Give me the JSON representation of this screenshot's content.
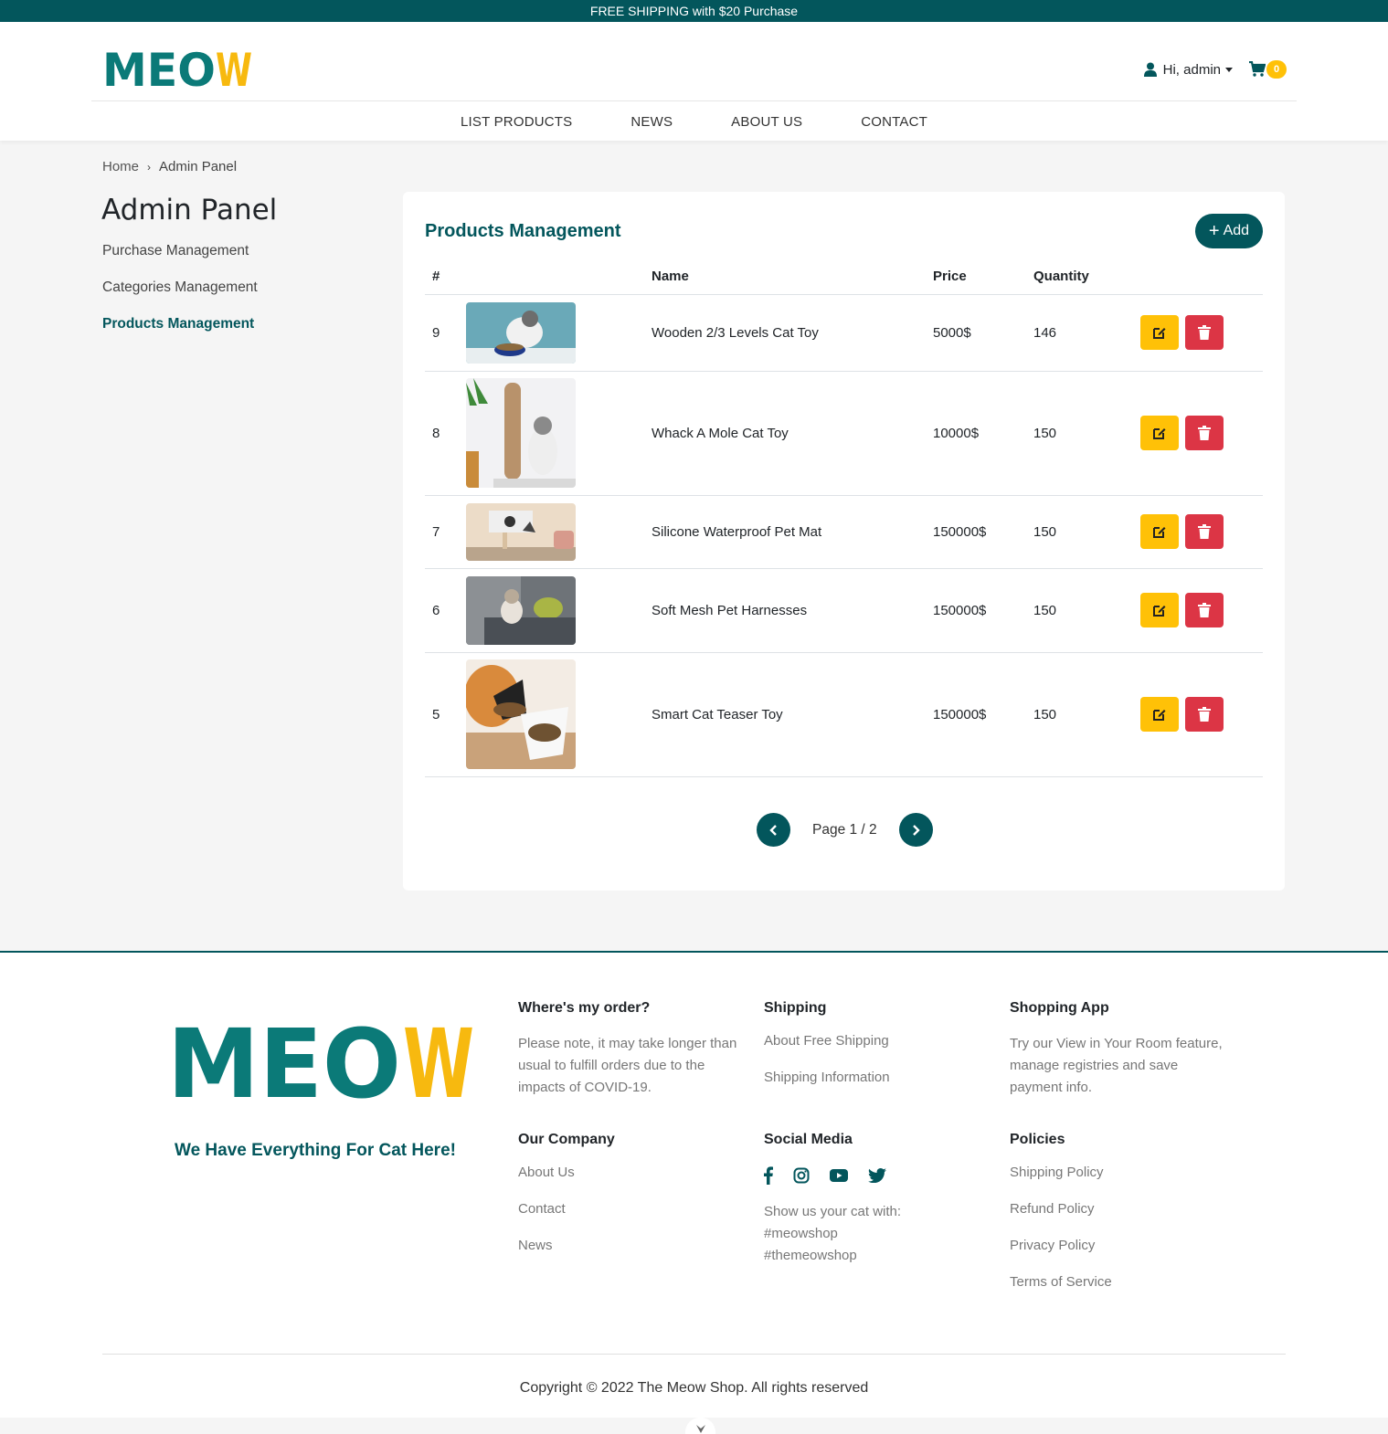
{
  "topbar": {
    "text": "FREE SHIPPING with $20 Purchase"
  },
  "header": {
    "logo_text": "MEOW",
    "greeting": "Hi,",
    "username": "admin",
    "cart_count": "0"
  },
  "nav": [
    "LIST PRODUCTS",
    "NEWS",
    "ABOUT US",
    "CONTACT"
  ],
  "breadcrumb": {
    "home": "Home",
    "current": "Admin Panel"
  },
  "page_title": "Admin Panel",
  "side_menu": [
    "Purchase Management",
    "Categories Management",
    "Products Management"
  ],
  "products": {
    "title": "Products Management",
    "add_label": "Add",
    "columns": [
      "#",
      "",
      "Name",
      "Price",
      "Quantity"
    ],
    "rows": [
      {
        "id": "9",
        "name": "Wooden 2/3 Levels Cat Toy",
        "price": "5000$",
        "qty": "146"
      },
      {
        "id": "8",
        "name": "Whack A Mole Cat Toy",
        "price": "10000$",
        "qty": "150"
      },
      {
        "id": "7",
        "name": "Silicone Waterproof Pet Mat",
        "price": "150000$",
        "qty": "150"
      },
      {
        "id": "6",
        "name": "Soft Mesh Pet Harnesses",
        "price": "150000$",
        "qty": "150"
      },
      {
        "id": "5",
        "name": "Smart Cat Teaser Toy",
        "price": "150000$",
        "qty": "150"
      }
    ],
    "pager": "Page 1 / 2"
  },
  "footer": {
    "tagline": "We Have Everything For Cat Here!",
    "order": {
      "title": "Where's my order?",
      "text": "Please note, it may take longer than usual to fulfill orders due to the impacts of COVID-19."
    },
    "shipping": {
      "title": "Shipping",
      "links": [
        "About Free Shipping",
        "Shipping Information"
      ]
    },
    "app": {
      "title": "Shopping App",
      "text": "Try our View in Your Room feature, manage registries and save payment info."
    },
    "company": {
      "title": "Our Company",
      "links": [
        "About Us",
        "Contact",
        "News"
      ]
    },
    "social": {
      "title": "Social Media",
      "icons": [
        "facebook-icon",
        "instagram-icon",
        "youtube-icon",
        "twitter-icon"
      ],
      "line1": "Show us your cat with:",
      "line2": "#meowshop",
      "line3": "#themeowshop"
    },
    "policies": {
      "title": "Policies",
      "links": [
        "Shipping Policy",
        "Refund Policy",
        "Privacy Policy",
        "Terms of Service"
      ]
    },
    "copyright": "Copyright © 2022 The Meow Shop. All rights reserved"
  },
  "colors": {
    "brand": "#03565c",
    "accent": "#ffc107",
    "danger": "#dc3545",
    "logo_teal": "#0b7a78",
    "logo_yellow": "#f7b90f"
  }
}
